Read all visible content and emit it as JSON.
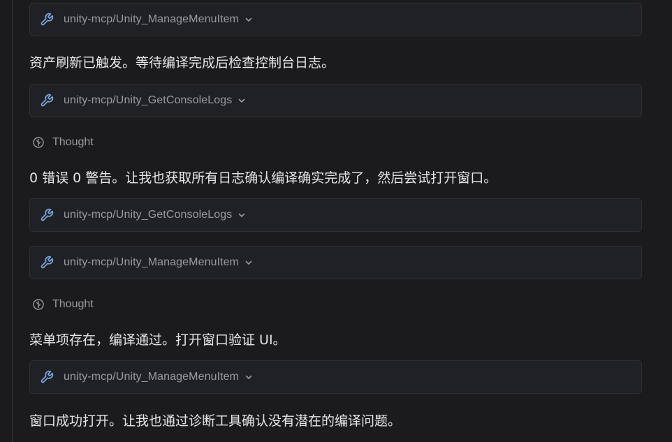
{
  "items": [
    {
      "kind": "tool",
      "label": "unity-mcp/Unity_ManageMenuItem"
    },
    {
      "kind": "message",
      "text": "资产刷新已触发。等待编译完成后检查控制台日志。"
    },
    {
      "kind": "tool",
      "label": "unity-mcp/Unity_GetConsoleLogs"
    },
    {
      "kind": "thought",
      "label": "Thought"
    },
    {
      "kind": "message",
      "text": "0 错误 0 警告。让我也获取所有日志确认编译确实完成了，然后尝试打开窗口。"
    },
    {
      "kind": "tool",
      "label": "unity-mcp/Unity_GetConsoleLogs"
    },
    {
      "kind": "tool",
      "label": "unity-mcp/Unity_ManageMenuItem"
    },
    {
      "kind": "thought",
      "label": "Thought"
    },
    {
      "kind": "message",
      "text": "菜单项存在，编译通过。打开窗口验证 UI。"
    },
    {
      "kind": "tool",
      "label": "unity-mcp/Unity_ManageMenuItem"
    },
    {
      "kind": "message",
      "text": "窗口成功打开。让我也通过诊断工具确认没有潜在的编译问题。"
    }
  ],
  "colors": {
    "background": "#1b1b1d",
    "card_background": "#202124",
    "card_border": "#303034",
    "icon_accent": "#7aa7e0",
    "muted_text": "#9a9ba0",
    "body_text": "#e6e6e8"
  },
  "icons": {
    "tool": "wrench-icon",
    "expand": "chevron-down-icon",
    "thought": "thought-icon"
  }
}
